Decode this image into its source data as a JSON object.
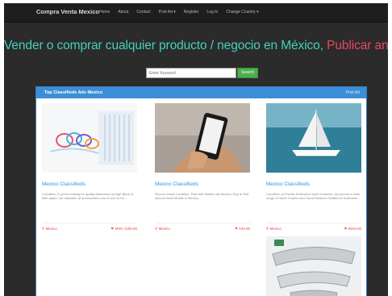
{
  "navbar": {
    "brand": "Compra Venta Mexico",
    "items": [
      "Home",
      "About",
      "Contact",
      "Post Ad ▾",
      "Register",
      "Log In",
      "Change Country ▾"
    ]
  },
  "hero": {
    "main": "Vender o comprar cualquier producto / negocio en México,",
    "cta": "Publicar anuncio gratis"
  },
  "search": {
    "placeholder": "Enter Keyword",
    "button": "Search"
  },
  "panel": {
    "title": "Top Classifieds Ads Mexico",
    "link": "Post Ad"
  },
  "cards": [
    {
      "title": "Mexico Classifieds",
      "desc": "Condition: If you're looking for quality laboratory syringe filters or filter paper, our selection at accessories.com is sure to fur ...",
      "location": "Mexico",
      "price": "MXN 1200.00",
      "image": "syringe-filters-image"
    },
    {
      "title": "Mexico Classifieds",
      "desc": "Second Hand Condition: Post free Mobile ads Mexico, Buy or Sell second hand Mobile in Mexico.",
      "location": "Mexico",
      "price": "240.00",
      "image": "mobile-phone-image"
    },
    {
      "title": "Mexico Classifieds",
      "desc": "Condition: At Pacific Northwest Yacht Charters, we provide a wide range of Yacht Charter and Yacht Rental in Seattle for individual ...",
      "location": "Mexico",
      "price": "9843.00",
      "image": "yacht-image"
    },
    {
      "image": "car-bumper-image"
    }
  ],
  "colors": {
    "accent": "#45d0c4",
    "cta": "#e9485c",
    "panel": "#3b8ed8",
    "search_button": "#4cae4c",
    "title_link": "#3a8fd6",
    "meta": "#e0453b"
  },
  "icons": {
    "location": "map-marker-icon",
    "price": "tag-icon"
  }
}
